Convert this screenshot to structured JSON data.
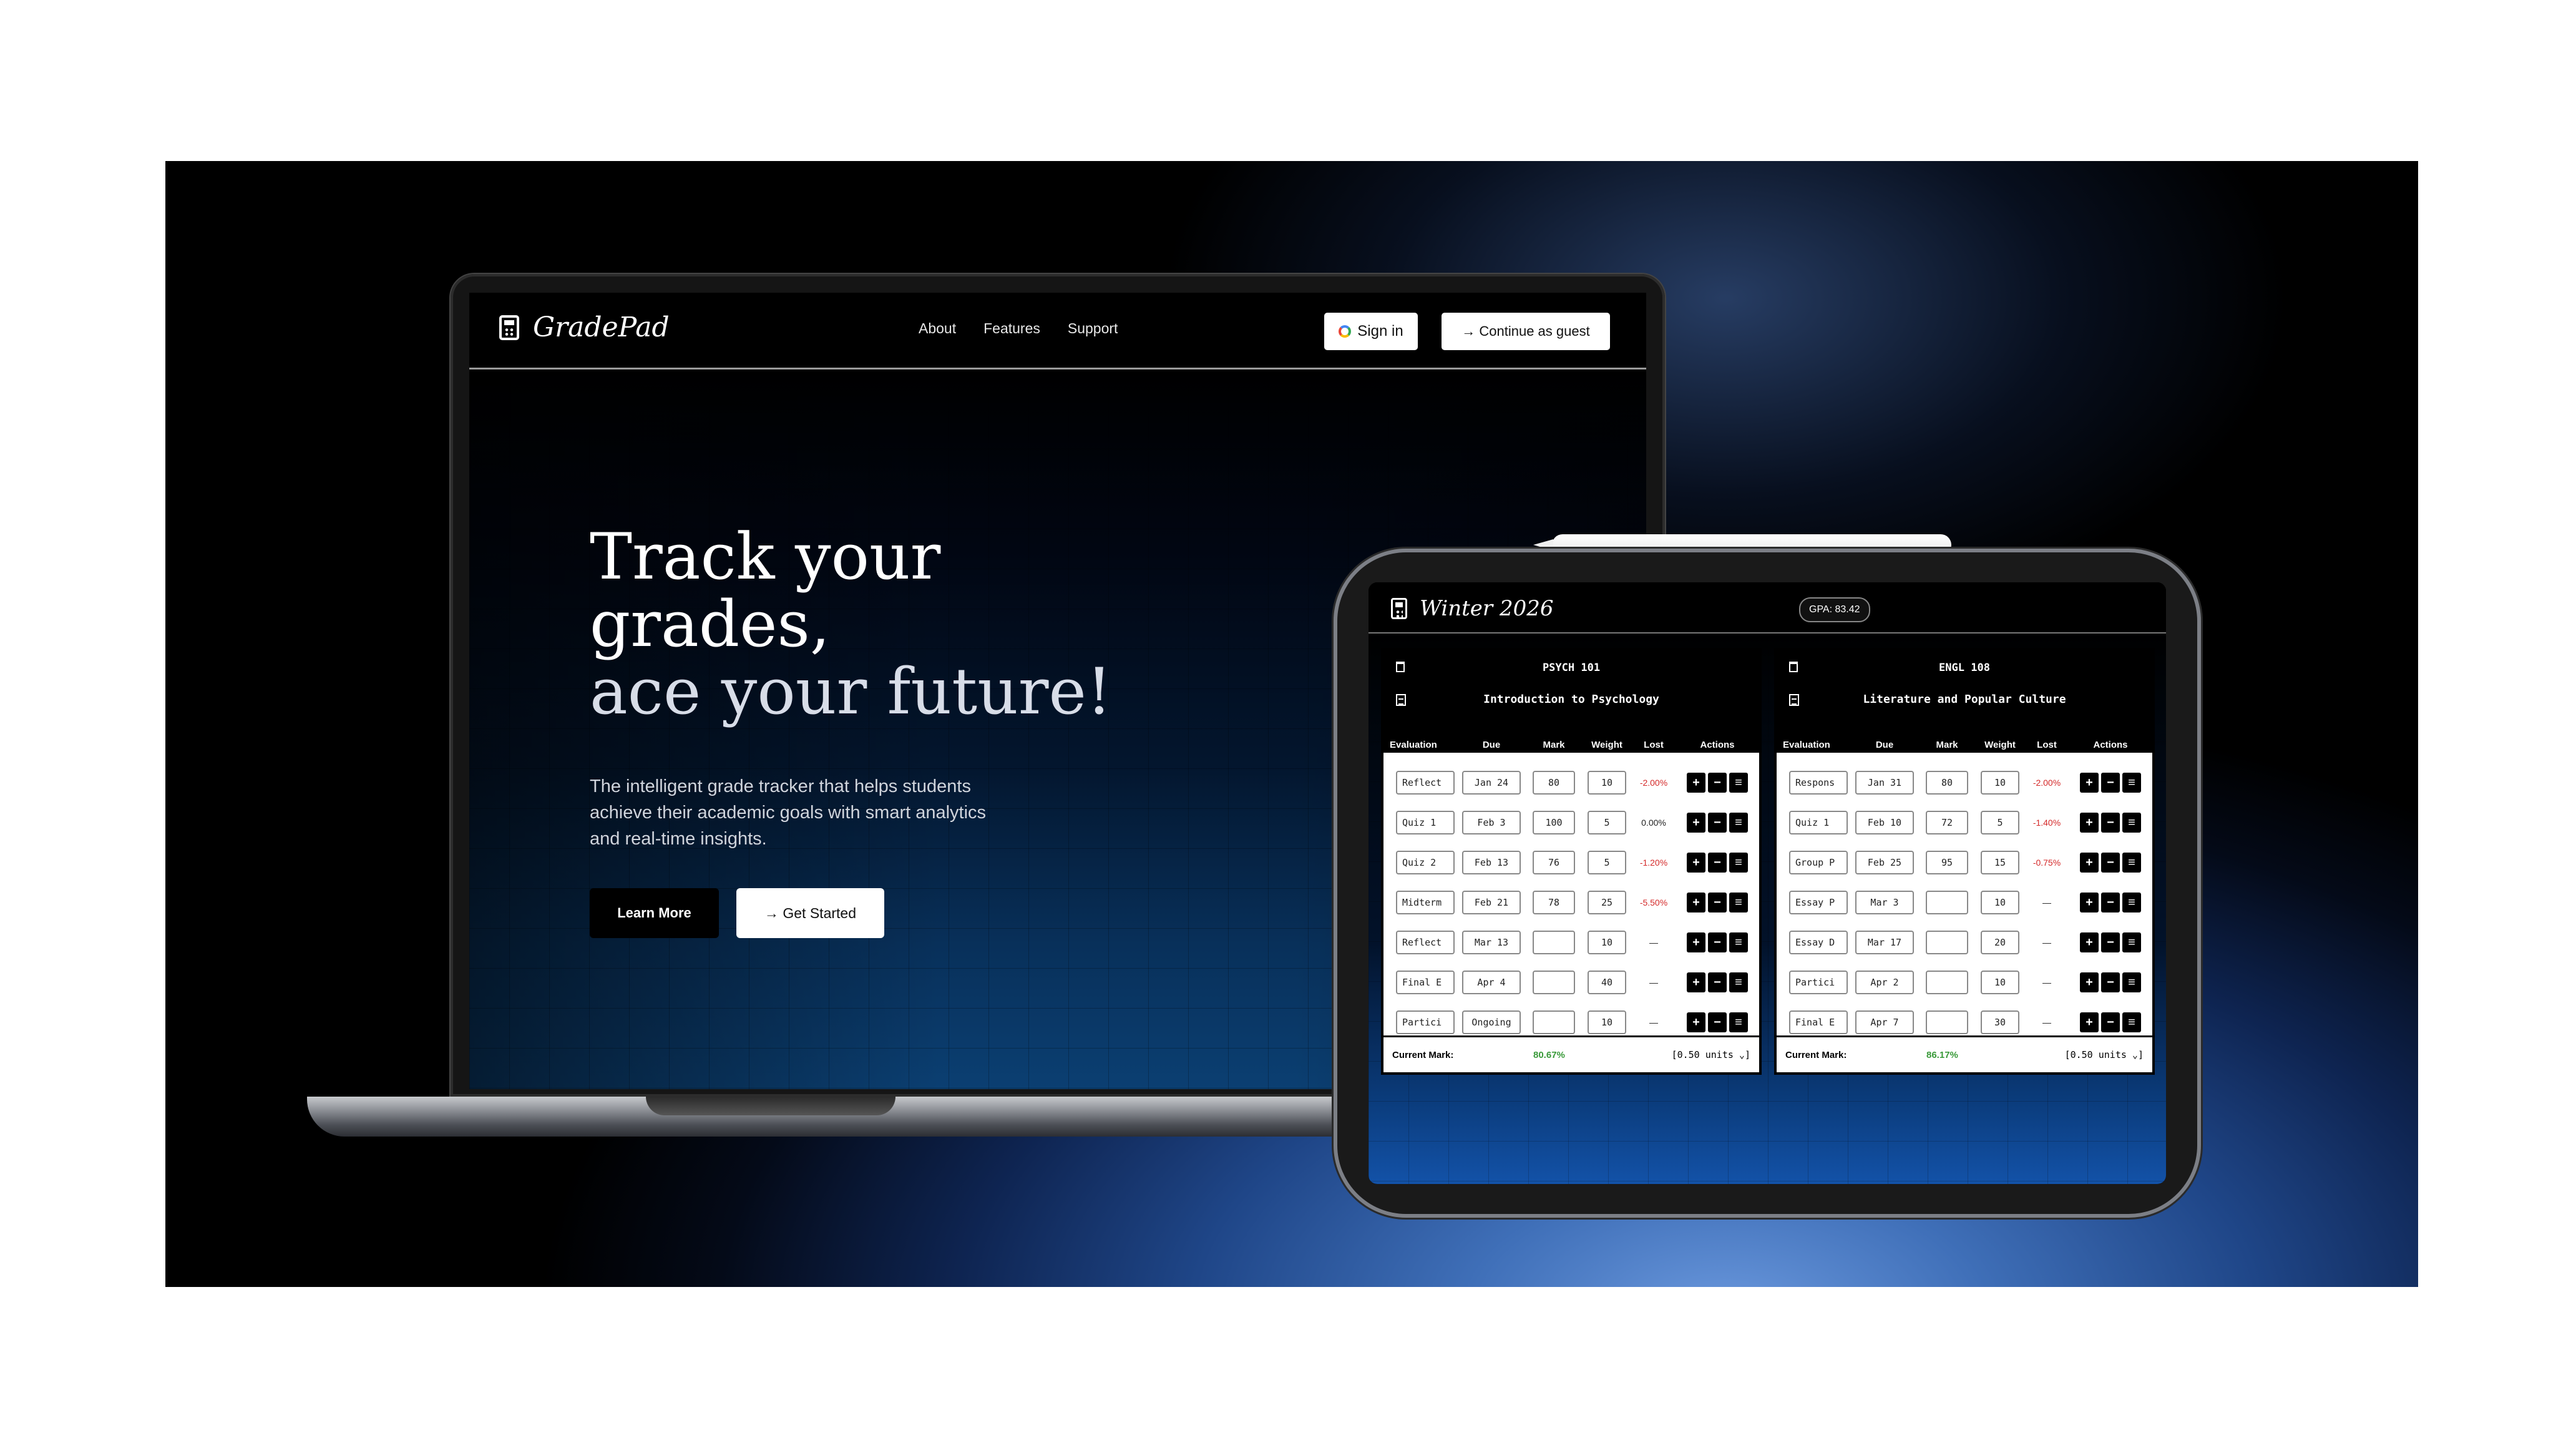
{
  "laptop": {
    "brand": "GradePad",
    "nav": [
      "About",
      "Features",
      "Support"
    ],
    "sign_in": "Sign in",
    "guest": "→ Continue as guest",
    "hero_line1": "Track your",
    "hero_line2": "grades,",
    "hero_line3": "ace your future!",
    "subtitle": "The intelligent grade tracker that helps students achieve their academic goals with smart analytics and real-time insights.",
    "learn_more": "Learn More",
    "get_started": "→ Get Started"
  },
  "tablet": {
    "term": "Winter 2026",
    "gpa": "GPA: 83.42",
    "columns": [
      "Evaluation",
      "Due",
      "Mark",
      "Weight",
      "Lost",
      "Actions"
    ],
    "courses": [
      {
        "code": "PSYCH 101",
        "name": "Introduction to Psychology",
        "rows": [
          {
            "eval": "Reflect",
            "due": "Jan 24",
            "mark": "80",
            "weight": "10",
            "lost": "-2.00%"
          },
          {
            "eval": "Quiz 1",
            "due": "Feb 3",
            "mark": "100",
            "weight": "5",
            "lost": "0.00%"
          },
          {
            "eval": "Quiz 2",
            "due": "Feb 13",
            "mark": "76",
            "weight": "5",
            "lost": "-1.20%"
          },
          {
            "eval": "Midterm",
            "due": "Feb 21",
            "mark": "78",
            "weight": "25",
            "lost": "-5.50%"
          },
          {
            "eval": "Reflect",
            "due": "Mar 13",
            "mark": "",
            "weight": "10",
            "lost": "—"
          },
          {
            "eval": "Final E",
            "due": "Apr 4",
            "mark": "",
            "weight": "40",
            "lost": "—"
          },
          {
            "eval": "Partici",
            "due": "Ongoing",
            "mark": "",
            "weight": "10",
            "lost": "—"
          }
        ],
        "current_label": "Current Mark:",
        "current_mark": "80.67%",
        "units": "[0.50 units ⌄]"
      },
      {
        "code": "ENGL 108",
        "name": "Literature and Popular Culture",
        "rows": [
          {
            "eval": "Respons",
            "due": "Jan 31",
            "mark": "80",
            "weight": "10",
            "lost": "-2.00%"
          },
          {
            "eval": "Quiz 1",
            "due": "Feb 10",
            "mark": "72",
            "weight": "5",
            "lost": "-1.40%"
          },
          {
            "eval": "Group P",
            "due": "Feb 25",
            "mark": "95",
            "weight": "15",
            "lost": "-0.75%"
          },
          {
            "eval": "Essay P",
            "due": "Mar 3",
            "mark": "",
            "weight": "10",
            "lost": "—"
          },
          {
            "eval": "Essay D",
            "due": "Mar 17",
            "mark": "",
            "weight": "20",
            "lost": "—"
          },
          {
            "eval": "Partici",
            "due": "Apr 2",
            "mark": "",
            "weight": "10",
            "lost": "—"
          },
          {
            "eval": "Final E",
            "due": "Apr 7",
            "mark": "",
            "weight": "30",
            "lost": "—"
          }
        ],
        "current_label": "Current Mark:",
        "current_mark": "86.17%",
        "units": "[0.50 units ⌄]"
      }
    ],
    "action_labels": [
      "+",
      "−",
      "≡"
    ]
  },
  "colors": {
    "accent_green": "#3a9a3a",
    "loss_red": "#d42a2a",
    "bg_navy": "#0b3f72"
  }
}
